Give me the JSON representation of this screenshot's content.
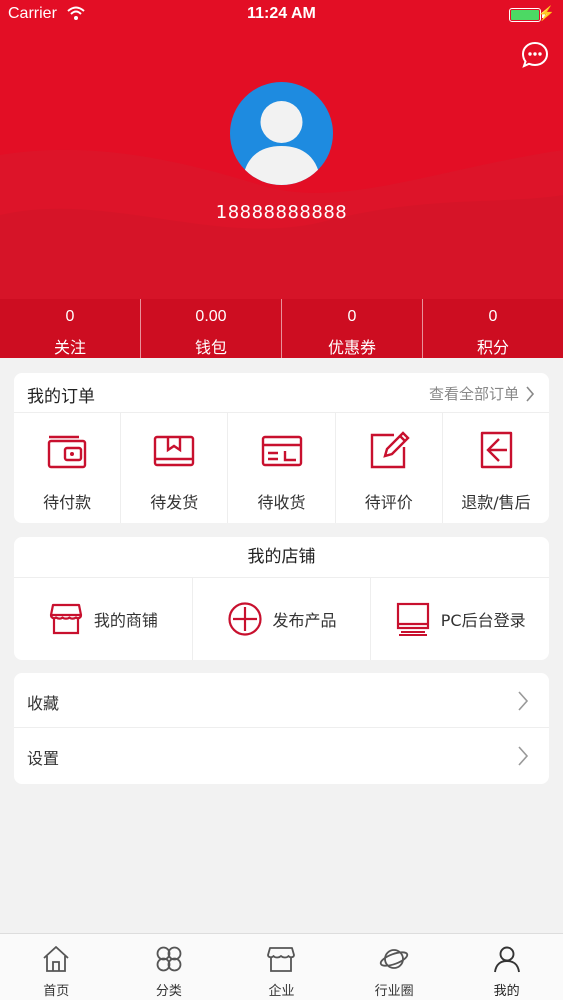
{
  "status_bar": {
    "carrier": "Carrier",
    "time": "11:24 AM"
  },
  "profile": {
    "phone": "18888888888"
  },
  "stats": [
    {
      "value": "0",
      "label": "关注"
    },
    {
      "value": "0.00",
      "label": "钱包"
    },
    {
      "value": "0",
      "label": "优惠券"
    },
    {
      "value": "0",
      "label": "积分"
    }
  ],
  "orders": {
    "title": "我的订单",
    "view_all": "查看全部订单",
    "items": [
      {
        "label": "待付款",
        "icon": "wallet-icon"
      },
      {
        "label": "待发货",
        "icon": "package-icon"
      },
      {
        "label": "待收货",
        "icon": "card-icon"
      },
      {
        "label": "待评价",
        "icon": "edit-icon"
      },
      {
        "label": "退款/售后",
        "icon": "return-icon"
      }
    ]
  },
  "shop": {
    "title": "我的店铺",
    "items": [
      {
        "label": "我的商铺",
        "icon": "store-icon"
      },
      {
        "label": "发布产品",
        "icon": "plus-circle-icon"
      },
      {
        "label": "PC后台登录",
        "icon": "monitor-icon"
      }
    ]
  },
  "menu": [
    {
      "label": "收藏"
    },
    {
      "label": "设置"
    }
  ],
  "tabbar": [
    {
      "label": "首页",
      "icon": "home-icon"
    },
    {
      "label": "分类",
      "icon": "category-icon"
    },
    {
      "label": "企业",
      "icon": "enterprise-icon"
    },
    {
      "label": "行业圈",
      "icon": "planet-icon"
    },
    {
      "label": "我的",
      "icon": "user-icon"
    }
  ],
  "colors": {
    "brand": "#e30e25",
    "tab_active": "#222222"
  }
}
